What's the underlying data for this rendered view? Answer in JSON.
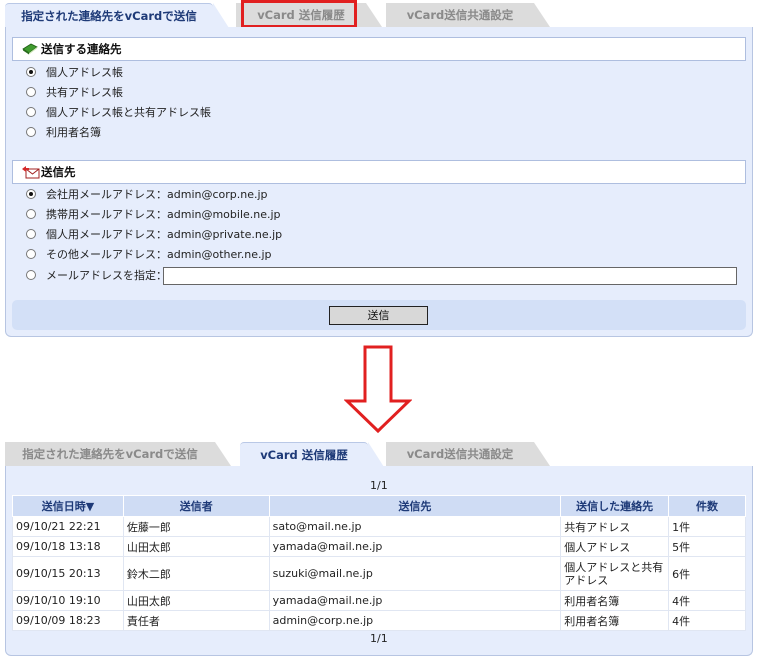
{
  "top": {
    "tabs": [
      {
        "label": "指定された連絡先をvCardで送信"
      },
      {
        "label": "vCard 送信履歴"
      },
      {
        "label": "vCard送信共通設定"
      }
    ],
    "contacts_section": {
      "title": "送信する連絡先",
      "options": [
        "個人アドレス帳",
        "共有アドレス帳",
        "個人アドレス帳と共有アドレス帳",
        "利用者名簿"
      ],
      "selected": 0
    },
    "destination_section": {
      "title": "送信先",
      "options": [
        "会社用メールアドレス：admin@corp.ne.jp",
        "携帯用メールアドレス：admin@mobile.ne.jp",
        "個人用メールアドレス：admin@private.ne.jp",
        "その他メールアドレス：admin@other.ne.jp",
        "メールアドレスを指定："
      ],
      "selected": 0,
      "custom_email_value": ""
    },
    "send_button": "送信"
  },
  "bottom": {
    "tabs": [
      {
        "label": "指定された連絡先をvCardで送信"
      },
      {
        "label": "vCard 送信履歴"
      },
      {
        "label": "vCard送信共通設定"
      }
    ],
    "pager_top": "1/1",
    "pager_bottom": "1/1",
    "table": {
      "headers": [
        "送信日時▼",
        "送信者",
        "送信先",
        "送信した連絡先",
        "件数"
      ],
      "rows": [
        [
          "09/10/21 22:21",
          "佐藤一郎",
          "sato@mail.ne.jp",
          "共有アドレス",
          "1件"
        ],
        [
          "09/10/18 13:18",
          "山田太郎",
          "yamada@mail.ne.jp",
          "個人アドレス",
          "5件"
        ],
        [
          "09/10/15 20:13",
          "鈴木二郎",
          "suzuki@mail.ne.jp",
          "個人アドレスと共有アドレス",
          "6件"
        ],
        [
          "09/10/10 19:10",
          "山田太郎",
          "yamada@mail.ne.jp",
          "利用者名簿",
          "4件"
        ],
        [
          "09/10/09 18:23",
          "責任者",
          "admin@corp.ne.jp",
          "利用者名簿",
          "4件"
        ]
      ]
    }
  },
  "colors": {
    "panel_bg": "#e6edfc",
    "header_bg": "#cfdcf4",
    "highlight": "#e12020",
    "arrow": "#e12020"
  }
}
